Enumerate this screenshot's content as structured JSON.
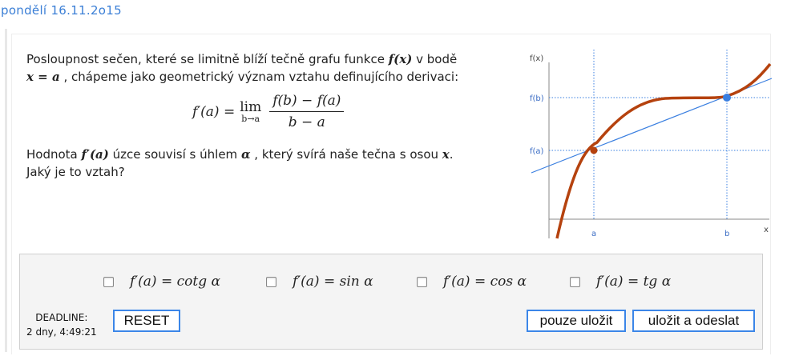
{
  "header": {
    "date": "pondělí 16.11.2o15"
  },
  "question": {
    "p1_a": "Posloupnost sečen, které se limitně blíží tečně grafu funkce",
    "p1_fx": "f(x)",
    "p1_b": "v bodě",
    "p1_xa": "x = a",
    "p1_c": ", chápeme jako geometrický význam vztahu definujícího derivaci:",
    "formula": {
      "lhs": "f′(a) =",
      "lim": "lim",
      "lim_sub": "b→a",
      "numerator": "f(b) − f(a)",
      "denominator": "b − a"
    },
    "p2_a": "Hodnota",
    "p2_fpa": "f′(a)",
    "p2_b": "úzce souvisí s úhlem",
    "p2_alpha": "α",
    "p2_c": ", který svírá naše tečna s osou",
    "p2_x": "x",
    "p2_d": ".",
    "p2_e": "Jaký je to vztah?"
  },
  "graph": {
    "y_axis_label": "f(x)",
    "x_axis_label": "x",
    "y_tick_fb": "f(b)",
    "y_tick_fa": "f(a)",
    "x_tick_a": "a",
    "x_tick_b": "b",
    "colors": {
      "curve": "#b5420e",
      "tangent": "#3a7fe0",
      "guides": "#3a7fe0",
      "points_a": "#b5420e",
      "point_b": "#3a7fe0"
    }
  },
  "answers": {
    "options": [
      {
        "label": "f′(a) = cotg α"
      },
      {
        "label": "f′(a) = sin α"
      },
      {
        "label": "f′(a) = cos α"
      },
      {
        "label": "f′(a) = tg α"
      }
    ]
  },
  "footer": {
    "deadline_label": "DEADLINE:",
    "deadline_value": "2 dny, 4:49:21",
    "reset_label": "RESET",
    "save_label": "pouze uložit",
    "submit_label": "uložit a odeslat"
  },
  "colors": {
    "accent": "#3b86e8",
    "date": "#3b7fd6"
  }
}
